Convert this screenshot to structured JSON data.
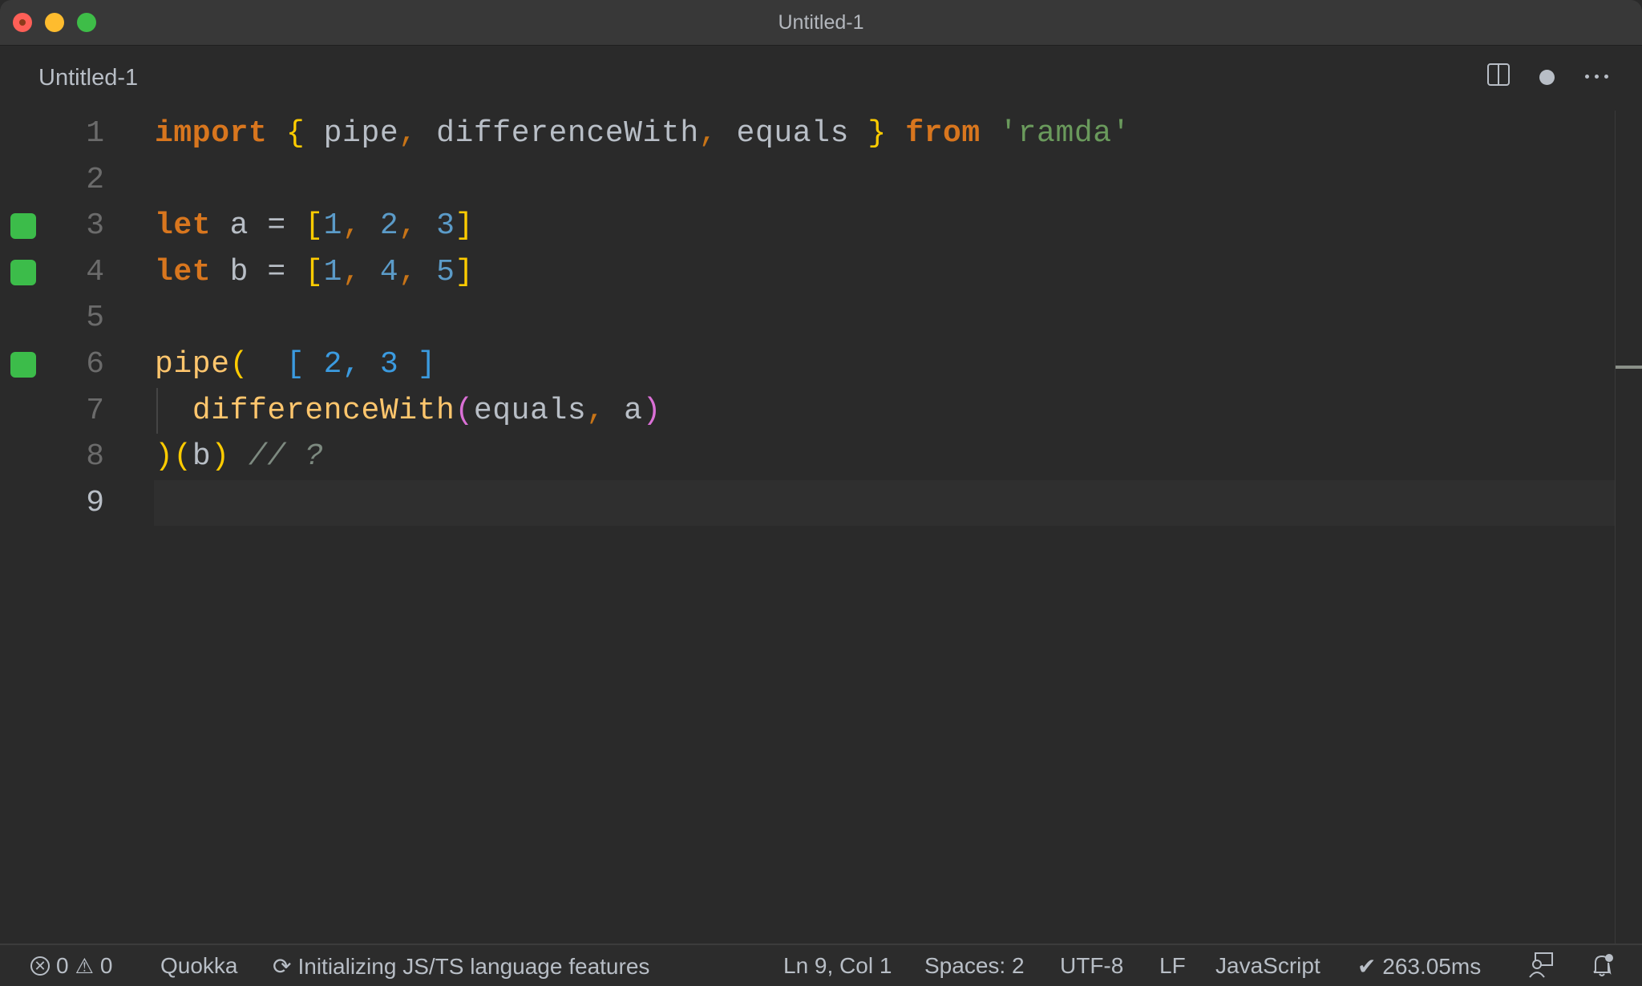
{
  "window": {
    "title": "Untitled-1",
    "controls": [
      "close",
      "minimize",
      "maximize"
    ]
  },
  "tab": {
    "label": "Untitled-1",
    "actions": [
      {
        "name": "split-editor-icon"
      },
      {
        "name": "unsaved-dot-icon"
      },
      {
        "name": "more-actions-icon"
      }
    ]
  },
  "editor": {
    "current_line": 9,
    "quokka_markers": [
      3,
      4,
      6
    ],
    "lines": [
      {
        "number": "1",
        "tokens": [
          {
            "t": "import",
            "c": "kw"
          },
          {
            "t": " ",
            "c": ""
          },
          {
            "t": "{",
            "c": "br-y"
          },
          {
            "t": " pipe",
            "c": ""
          },
          {
            "t": ",",
            "c": "com"
          },
          {
            "t": " differenceWith",
            "c": ""
          },
          {
            "t": ",",
            "c": "com"
          },
          {
            "t": " equals ",
            "c": ""
          },
          {
            "t": "}",
            "c": "br-y"
          },
          {
            "t": " ",
            "c": ""
          },
          {
            "t": "from",
            "c": "kw"
          },
          {
            "t": " ",
            "c": ""
          },
          {
            "t": "'ramda'",
            "c": "str"
          }
        ]
      },
      {
        "number": "2",
        "tokens": []
      },
      {
        "number": "3",
        "tokens": [
          {
            "t": "let",
            "c": "kw"
          },
          {
            "t": " a = ",
            "c": ""
          },
          {
            "t": "[",
            "c": "br-y"
          },
          {
            "t": "1",
            "c": "num"
          },
          {
            "t": ",",
            "c": "com"
          },
          {
            "t": " ",
            "c": ""
          },
          {
            "t": "2",
            "c": "num"
          },
          {
            "t": ",",
            "c": "com"
          },
          {
            "t": " ",
            "c": ""
          },
          {
            "t": "3",
            "c": "num"
          },
          {
            "t": "]",
            "c": "br-y"
          }
        ]
      },
      {
        "number": "4",
        "tokens": [
          {
            "t": "let",
            "c": "kw"
          },
          {
            "t": " b = ",
            "c": ""
          },
          {
            "t": "[",
            "c": "br-y"
          },
          {
            "t": "1",
            "c": "num"
          },
          {
            "t": ",",
            "c": "com"
          },
          {
            "t": " ",
            "c": ""
          },
          {
            "t": "4",
            "c": "num"
          },
          {
            "t": ",",
            "c": "com"
          },
          {
            "t": " ",
            "c": ""
          },
          {
            "t": "5",
            "c": "num"
          },
          {
            "t": "]",
            "c": "br-y"
          }
        ]
      },
      {
        "number": "5",
        "tokens": []
      },
      {
        "number": "6",
        "tokens": [
          {
            "t": "pipe",
            "c": "fn"
          },
          {
            "t": "(",
            "c": "br-y"
          },
          {
            "t": "  [ 2, 3 ]",
            "c": "qres"
          }
        ]
      },
      {
        "number": "7",
        "tokens": [
          {
            "t": "  ",
            "c": ""
          },
          {
            "t": "differenceWith",
            "c": "fn"
          },
          {
            "t": "(",
            "c": "br-p"
          },
          {
            "t": "equals",
            "c": ""
          },
          {
            "t": ",",
            "c": "com"
          },
          {
            "t": " a",
            "c": ""
          },
          {
            "t": ")",
            "c": "br-p"
          }
        ]
      },
      {
        "number": "8",
        "tokens": [
          {
            "t": ")",
            "c": "br-y"
          },
          {
            "t": "(",
            "c": "br-y"
          },
          {
            "t": "b",
            "c": ""
          },
          {
            "t": ")",
            "c": "br-y"
          },
          {
            "t": " ",
            "c": ""
          },
          {
            "t": "// ?",
            "c": "cmt"
          }
        ]
      },
      {
        "number": "9",
        "tokens": []
      }
    ],
    "quokka_inline_result": "[ 2, 3 ]"
  },
  "statusbar": {
    "errors": "0",
    "warnings": "0",
    "quokka": "Quokka",
    "language_status": "Initializing JS/TS language features",
    "cursor_position": "Ln 9, Col 1",
    "indentation": "Spaces: 2",
    "encoding": "UTF-8",
    "line_ending": "LF",
    "language_mode": "JavaScript",
    "quokka_timing": "✔ 263.05ms"
  },
  "colors": {
    "quokka_marker": "#3cbc4a",
    "keyword": "#d8761e",
    "bracket_level1": "#ffcc00",
    "bracket_level2": "#da70d6",
    "number": "#5b9bc8",
    "string": "#6a9a5c",
    "function": "#ffc66d",
    "comment": "#7d8a80",
    "quokka_result": "#3b9be0"
  }
}
